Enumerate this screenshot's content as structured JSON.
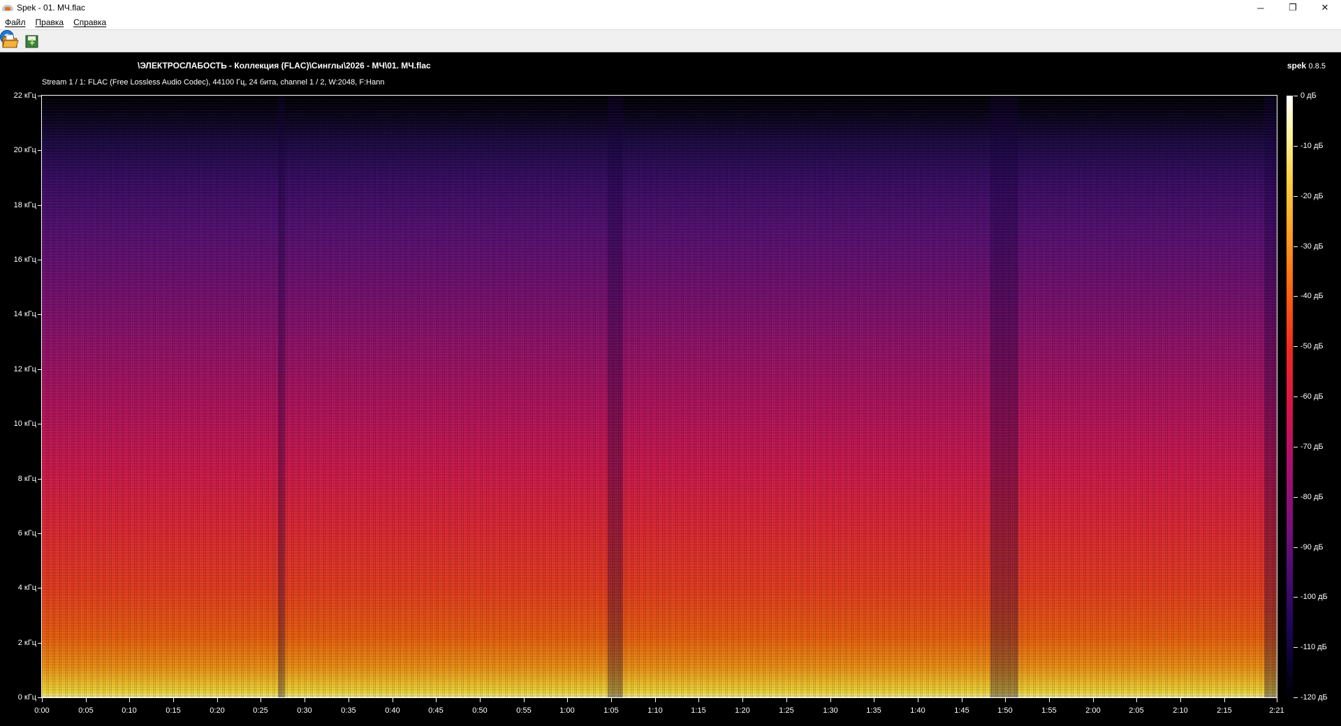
{
  "window": {
    "title": "Spek - 01. МЧ.flac",
    "minimize": "─",
    "maximize": "❐",
    "close": "✕"
  },
  "menu": {
    "items": [
      "Файл",
      "Правка",
      "Справка"
    ]
  },
  "toolbar": {
    "help": "?"
  },
  "header": {
    "file_path": "\\ЭЛЕКТРОСЛАБОСТЬ - Коллекция (FLAC)\\Синглы\\2026 - МЧ\\01. МЧ.flac",
    "brand": "spek",
    "version": "0.8.5",
    "stream_info": "Stream 1 / 1: FLAC (Free Lossless Audio Codec), 44100 Гц, 24 бита, channel 1 / 2, W:2048, F:Hann"
  },
  "freq_axis": [
    "22 кГц",
    "20 кГц",
    "18 кГц",
    "16 кГц",
    "14 кГц",
    "12 кГц",
    "10 кГц",
    "8 кГц",
    "6 кГц",
    "4 кГц",
    "2 кГц",
    "0 кГц"
  ],
  "time_axis": [
    "0:00",
    "0:05",
    "0:10",
    "0:15",
    "0:20",
    "0:25",
    "0:30",
    "0:35",
    "0:40",
    "0:45",
    "0:50",
    "0:55",
    "1:00",
    "1:05",
    "1:10",
    "1:15",
    "1:20",
    "1:25",
    "1:30",
    "1:35",
    "1:40",
    "1:45",
    "1:50",
    "1:55",
    "2:00",
    "2:05",
    "2:10",
    "2:15",
    "2:21"
  ],
  "db_axis": [
    "0 дБ",
    "-10 дБ",
    "-20 дБ",
    "-30 дБ",
    "-40 дБ",
    "-50 дБ",
    "-60 дБ",
    "-70 дБ",
    "-80 дБ",
    "-90 дБ",
    "-100 дБ",
    "-110 дБ",
    "-120 дБ"
  ]
}
